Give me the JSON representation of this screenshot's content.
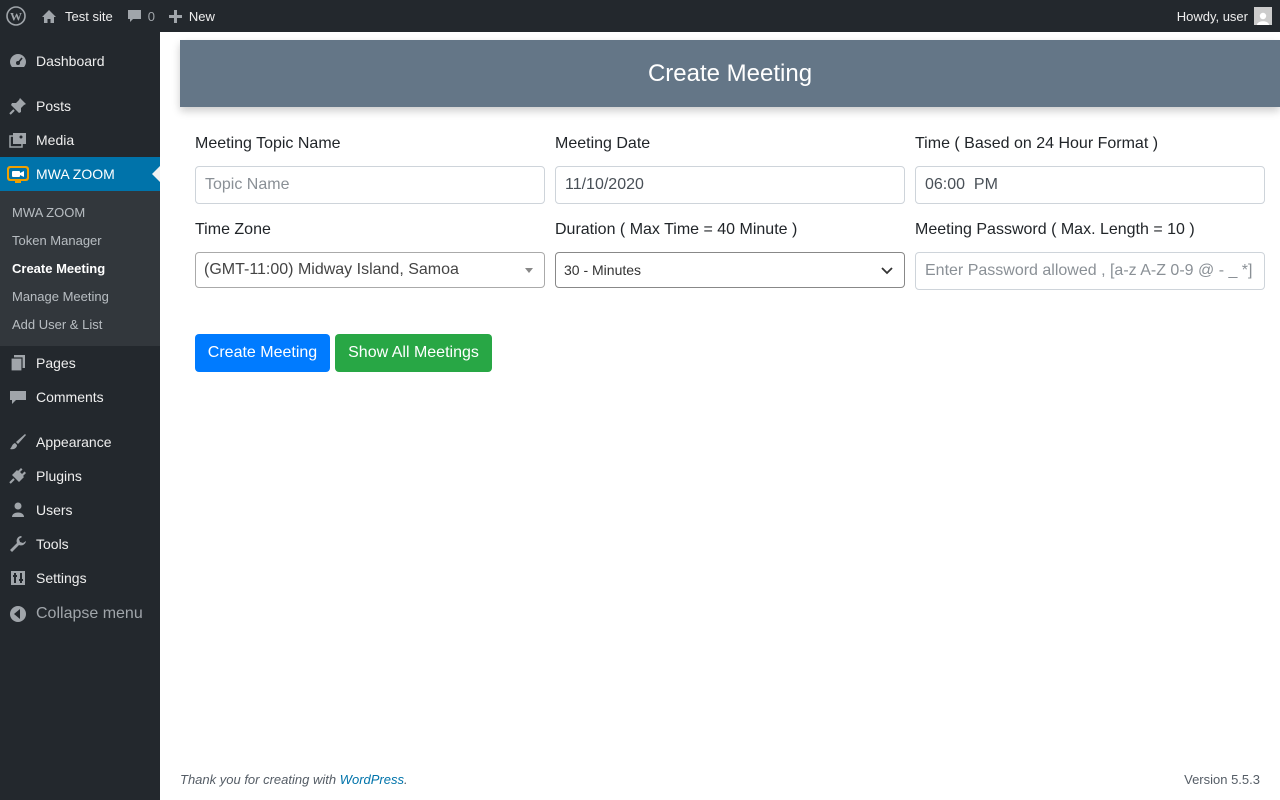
{
  "admin_bar": {
    "site_name": "Test site",
    "comments_count": "0",
    "new_label": "New",
    "greeting": "Howdy, user"
  },
  "sidebar": {
    "items": [
      {
        "label": "Dashboard",
        "icon": "dashboard-icon"
      },
      {
        "label": "Posts",
        "icon": "pin-icon"
      },
      {
        "label": "Media",
        "icon": "media-icon"
      },
      {
        "label": "MWA ZOOM",
        "icon": "zoom-icon"
      },
      {
        "label": "Pages",
        "icon": "pages-icon"
      },
      {
        "label": "Comments",
        "icon": "comment-icon"
      },
      {
        "label": "Appearance",
        "icon": "brush-icon"
      },
      {
        "label": "Plugins",
        "icon": "plug-icon"
      },
      {
        "label": "Users",
        "icon": "user-icon"
      },
      {
        "label": "Tools",
        "icon": "wrench-icon"
      },
      {
        "label": "Settings",
        "icon": "settings-icon"
      }
    ],
    "submenu": [
      "MWA ZOOM",
      "Token Manager",
      "Create Meeting",
      "Manage Meeting",
      "Add User & List"
    ],
    "collapse_label": "Collapse menu"
  },
  "page": {
    "title": "Create Meeting",
    "fields": {
      "topic": {
        "label": "Meeting Topic Name",
        "placeholder": "Topic Name"
      },
      "date": {
        "label": "Meeting Date",
        "value": "11/10/2020"
      },
      "time": {
        "label": "Time ( Based on 24 Hour Format )",
        "value": "06:00  PM"
      },
      "timezone": {
        "label": "Time Zone",
        "value": "(GMT-11:00) Midway Island, Samoa"
      },
      "duration": {
        "label": "Duration ( Max Time = 40 Minute )",
        "value": "30 - Minutes"
      },
      "password": {
        "label": "Meeting Password ( Max. Length = 10 )",
        "placeholder": "Enter Password allowed , [a-z A-Z 0-9 @ - _ *]"
      }
    },
    "buttons": {
      "create": "Create Meeting",
      "show_all": "Show All Meetings"
    }
  },
  "footer": {
    "thanks_prefix": "Thank you for creating with ",
    "thanks_link": "WordPress",
    "thanks_suffix": ".",
    "version": "Version 5.5.3"
  },
  "colors": {
    "admin_dark": "#23282d",
    "menu_active": "#0073aa",
    "header_bg": "#647687",
    "primary": "#007bff",
    "success": "#28a745"
  }
}
